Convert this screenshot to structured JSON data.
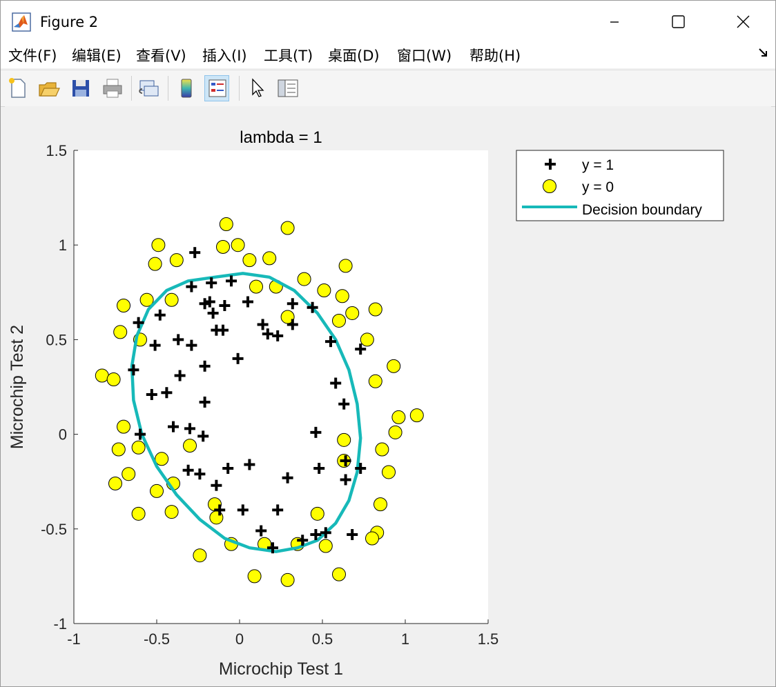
{
  "window": {
    "title": "Figure 2",
    "controls": {
      "minimize": "minimize",
      "maximize": "maximize",
      "close": "close"
    }
  },
  "menu": [
    "文件(F)",
    "编辑(E)",
    "查看(V)",
    "插入(I)",
    "工具(T)",
    "桌面(D)",
    "窗口(W)",
    "帮助(H)"
  ],
  "toolbar": [
    "new-figure-icon",
    "open-file-icon",
    "save-icon",
    "print-icon",
    "link-plot-icon",
    "colorbar-icon",
    "legend-icon",
    "pointer-icon",
    "property-inspector-icon"
  ],
  "colors": {
    "pos": "#000000",
    "neg_fill": "#ffff00",
    "boundary": "#17b9b9",
    "axes_bg": "#ffffff",
    "figure_bg": "#f0f0f0"
  },
  "chart_data": {
    "type": "scatter",
    "title": "lambda = 1",
    "xlabel": "Microchip Test 1",
    "ylabel": "Microchip Test 2",
    "xlim": [
      -1,
      1.5
    ],
    "ylim": [
      -1,
      1.5
    ],
    "xticks": [
      -1,
      -0.5,
      0,
      0.5,
      1,
      1.5
    ],
    "yticks": [
      -1,
      -0.5,
      0,
      0.5,
      1,
      1.5
    ],
    "xtick_labels": [
      "-1",
      "-0.5",
      "0",
      "0.5",
      "1",
      "1.5"
    ],
    "ytick_labels": [
      "-1",
      "-0.5",
      "0",
      "0.5",
      "1",
      "1.5"
    ],
    "legend_position": "outside-top-right",
    "legend": [
      "y = 1",
      "y = 0",
      "Decision boundary"
    ],
    "series": [
      {
        "name": "y = 1",
        "marker": "plus",
        "points": [
          [
            -0.27,
            0.96
          ],
          [
            -0.29,
            0.78
          ],
          [
            -0.17,
            0.8
          ],
          [
            -0.05,
            0.81
          ],
          [
            -0.21,
            0.69
          ],
          [
            -0.18,
            0.7
          ],
          [
            -0.16,
            0.64
          ],
          [
            -0.09,
            0.68
          ],
          [
            0.05,
            0.7
          ],
          [
            -0.48,
            0.63
          ],
          [
            -0.61,
            0.59
          ],
          [
            -0.51,
            0.47
          ],
          [
            -0.37,
            0.5
          ],
          [
            -0.29,
            0.47
          ],
          [
            -0.14,
            0.55
          ],
          [
            -0.1,
            0.55
          ],
          [
            0.14,
            0.58
          ],
          [
            0.17,
            0.53
          ],
          [
            0.23,
            0.52
          ],
          [
            0.32,
            0.69
          ],
          [
            0.44,
            0.67
          ],
          [
            0.32,
            0.58
          ],
          [
            -0.01,
            0.4
          ],
          [
            -0.64,
            0.34
          ],
          [
            -0.36,
            0.31
          ],
          [
            -0.21,
            0.36
          ],
          [
            0.55,
            0.49
          ],
          [
            0.73,
            0.45
          ],
          [
            -0.53,
            0.21
          ],
          [
            -0.44,
            0.22
          ],
          [
            -0.21,
            0.17
          ],
          [
            0.58,
            0.27
          ],
          [
            0.63,
            0.16
          ],
          [
            -0.6,
            0.0
          ],
          [
            -0.4,
            0.04
          ],
          [
            -0.3,
            0.03
          ],
          [
            -0.22,
            -0.01
          ],
          [
            0.46,
            0.01
          ],
          [
            -0.31,
            -0.19
          ],
          [
            -0.24,
            -0.21
          ],
          [
            -0.14,
            -0.27
          ],
          [
            -0.07,
            -0.18
          ],
          [
            0.06,
            -0.16
          ],
          [
            0.29,
            -0.23
          ],
          [
            0.48,
            -0.18
          ],
          [
            0.64,
            -0.14
          ],
          [
            0.64,
            -0.24
          ],
          [
            0.73,
            -0.18
          ],
          [
            -0.12,
            -0.4
          ],
          [
            0.02,
            -0.4
          ],
          [
            0.23,
            -0.4
          ],
          [
            0.13,
            -0.51
          ],
          [
            0.2,
            -0.6
          ],
          [
            0.38,
            -0.56
          ],
          [
            0.46,
            -0.53
          ],
          [
            0.52,
            -0.52
          ],
          [
            0.68,
            -0.53
          ]
        ]
      },
      {
        "name": "y = 0",
        "marker": "circle",
        "points": [
          [
            -0.08,
            1.11
          ],
          [
            0.29,
            1.09
          ],
          [
            -0.49,
            1.0
          ],
          [
            -0.1,
            0.99
          ],
          [
            -0.01,
            1.0
          ],
          [
            -0.51,
            0.9
          ],
          [
            -0.38,
            0.92
          ],
          [
            0.06,
            0.92
          ],
          [
            0.18,
            0.93
          ],
          [
            0.64,
            0.89
          ],
          [
            0.39,
            0.82
          ],
          [
            0.1,
            0.78
          ],
          [
            0.22,
            0.78
          ],
          [
            0.51,
            0.76
          ],
          [
            0.62,
            0.73
          ],
          [
            -0.7,
            0.68
          ],
          [
            -0.56,
            0.71
          ],
          [
            -0.41,
            0.71
          ],
          [
            0.68,
            0.64
          ],
          [
            0.82,
            0.66
          ],
          [
            0.29,
            0.62
          ],
          [
            0.6,
            0.6
          ],
          [
            -0.72,
            0.54
          ],
          [
            -0.6,
            0.5
          ],
          [
            0.77,
            0.5
          ],
          [
            0.93,
            0.36
          ],
          [
            -0.83,
            0.31
          ],
          [
            -0.76,
            0.29
          ],
          [
            0.82,
            0.28
          ],
          [
            -0.7,
            0.04
          ],
          [
            0.96,
            0.09
          ],
          [
            1.07,
            0.1
          ],
          [
            0.94,
            0.01
          ],
          [
            -0.3,
            -0.06
          ],
          [
            0.63,
            -0.03
          ],
          [
            -0.73,
            -0.08
          ],
          [
            -0.61,
            -0.07
          ],
          [
            0.86,
            -0.08
          ],
          [
            -0.47,
            -0.13
          ],
          [
            0.63,
            -0.14
          ],
          [
            -0.67,
            -0.21
          ],
          [
            0.9,
            -0.2
          ],
          [
            -0.75,
            -0.26
          ],
          [
            -0.4,
            -0.26
          ],
          [
            -0.5,
            -0.3
          ],
          [
            -0.15,
            -0.37
          ],
          [
            0.85,
            -0.37
          ],
          [
            -0.61,
            -0.42
          ],
          [
            -0.41,
            -0.41
          ],
          [
            -0.14,
            -0.44
          ],
          [
            0.47,
            -0.42
          ],
          [
            0.83,
            -0.52
          ],
          [
            -0.05,
            -0.58
          ],
          [
            0.15,
            -0.58
          ],
          [
            0.35,
            -0.58
          ],
          [
            0.52,
            -0.59
          ],
          [
            0.8,
            -0.55
          ],
          [
            -0.24,
            -0.64
          ],
          [
            0.6,
            -0.74
          ],
          [
            0.09,
            -0.75
          ],
          [
            0.29,
            -0.77
          ]
        ]
      },
      {
        "name": "Decision boundary",
        "type": "line",
        "points": [
          [
            -0.15,
            0.83
          ],
          [
            0.02,
            0.85
          ],
          [
            0.18,
            0.83
          ],
          [
            0.33,
            0.76
          ],
          [
            0.47,
            0.64
          ],
          [
            0.58,
            0.5
          ],
          [
            0.66,
            0.34
          ],
          [
            0.71,
            0.16
          ],
          [
            0.73,
            -0.02
          ],
          [
            0.71,
            -0.2
          ],
          [
            0.66,
            -0.35
          ],
          [
            0.58,
            -0.47
          ],
          [
            0.47,
            -0.56
          ],
          [
            0.35,
            -0.6
          ],
          [
            0.22,
            -0.62
          ],
          [
            0.06,
            -0.6
          ],
          [
            -0.09,
            -0.55
          ],
          [
            -0.24,
            -0.45
          ],
          [
            -0.38,
            -0.32
          ],
          [
            -0.5,
            -0.17
          ],
          [
            -0.59,
            0.0
          ],
          [
            -0.64,
            0.18
          ],
          [
            -0.65,
            0.36
          ],
          [
            -0.62,
            0.52
          ],
          [
            -0.55,
            0.66
          ],
          [
            -0.44,
            0.76
          ],
          [
            -0.31,
            0.81
          ],
          [
            -0.15,
            0.83
          ]
        ]
      }
    ]
  }
}
